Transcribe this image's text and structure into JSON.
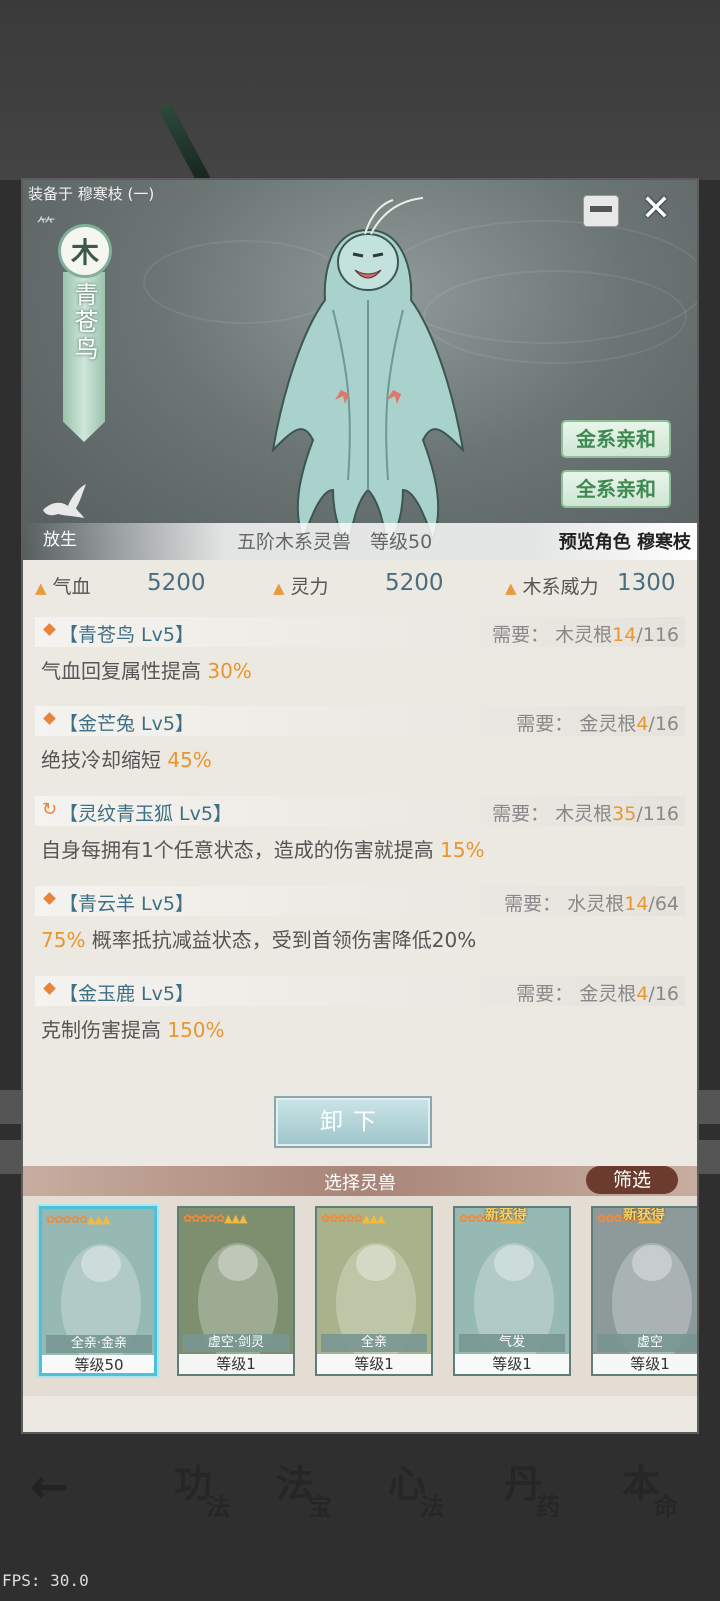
{
  "equipped_label": "装备于 穆寒枝 (一)",
  "element": "木",
  "beast_name": "青苍鸟",
  "release_label": "放生",
  "affinities": [
    "金系亲和",
    "全系亲和"
  ],
  "rank_text": "五阶木系灵兽　等级50",
  "preview_text": "预览角色 穆寒枝",
  "stats": [
    {
      "label": "气血",
      "value": "5200"
    },
    {
      "label": "灵力",
      "value": "5200"
    },
    {
      "label": "木系威力",
      "value": "1300"
    }
  ],
  "skills": [
    {
      "title": "【青苍鸟 Lv5】",
      "req_label": "需要：",
      "req_root": "木灵根",
      "req_have": "14",
      "req_need": "/116",
      "desc_pre": "气血回复属性提高 ",
      "desc_hl": "30%",
      "desc_post": "",
      "icon": "diamond"
    },
    {
      "title": "【金芒兔 Lv5】",
      "req_label": "需要：",
      "req_root": "金灵根",
      "req_have": "4",
      "req_need": "/16",
      "desc_pre": "绝技冷却缩短 ",
      "desc_hl": "45%",
      "desc_post": "",
      "icon": "diamond"
    },
    {
      "title": "【灵纹青玉狐 Lv5】",
      "req_label": "需要：",
      "req_root": "木灵根",
      "req_have": "35",
      "req_need": "/116",
      "desc_pre": "自身每拥有1个任意状态，造成的伤害就提高 ",
      "desc_hl": "15%",
      "desc_post": "",
      "icon": "refresh"
    },
    {
      "title": "【青云羊 Lv5】",
      "req_label": "需要：",
      "req_root": "水灵根",
      "req_have": "14",
      "req_need": "/64",
      "desc_pre": "",
      "desc_hl": "75%",
      "desc_post": " 概率抵抗减益状态，受到首领伤害降低20%",
      "icon": "diamond"
    },
    {
      "title": "【金玉鹿 Lv5】",
      "req_label": "需要：",
      "req_root": "金灵根",
      "req_have": "4",
      "req_need": "/16",
      "desc_pre": "克制伤害提高 ",
      "desc_hl": "150%",
      "desc_post": "",
      "icon": "diamond"
    }
  ],
  "unequip_label": "卸下",
  "select_title": "选择灵兽",
  "filter_label": "筛选",
  "cards": [
    {
      "tag": "全亲·金亲",
      "level": "等级50",
      "new": "",
      "selected": true
    },
    {
      "tag": "虚空·剑灵",
      "level": "等级1",
      "new": "",
      "selected": false
    },
    {
      "tag": "全亲",
      "level": "等级1",
      "new": "",
      "selected": false
    },
    {
      "tag": "气发",
      "level": "等级1",
      "new": "新获得",
      "selected": false
    },
    {
      "tag": "虚空",
      "level": "等级1",
      "new": "新获得",
      "selected": false
    }
  ],
  "nav": [
    {
      "big": "功",
      "small": "法"
    },
    {
      "big": "法",
      "small": "宝"
    },
    {
      "big": "心",
      "small": "法"
    },
    {
      "big": "丹",
      "small": "药"
    },
    {
      "big": "本",
      "small": "命"
    }
  ],
  "fps": "FPS: 30.0",
  "colors": {
    "accent_orange": "#e8962e",
    "stat_blue": "#4a6e80",
    "affinity_green": "#3f8a52",
    "filter_brown": "#6b3c2d"
  }
}
